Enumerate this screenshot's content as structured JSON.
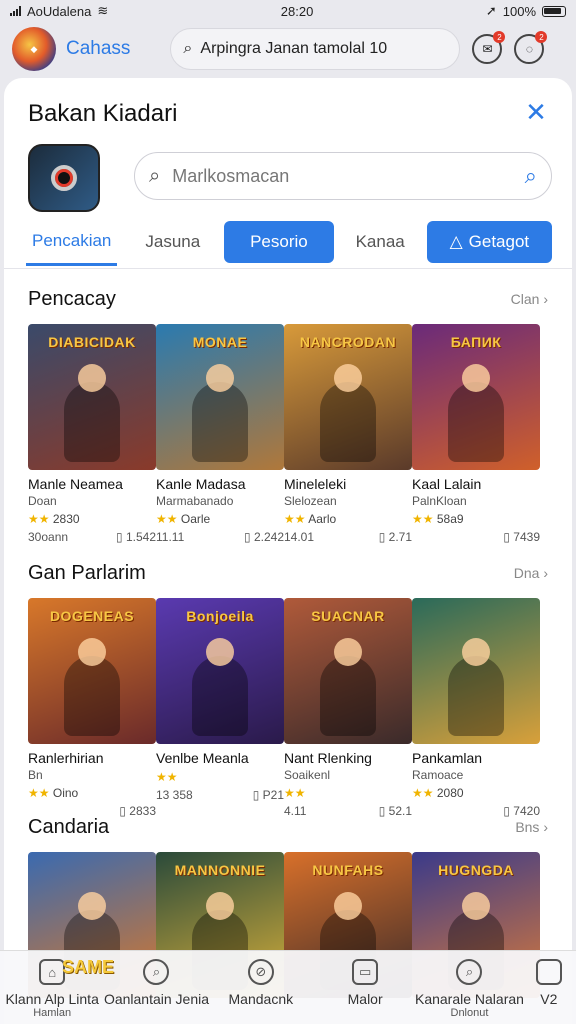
{
  "status": {
    "carrier": "AoUdalena",
    "time": "28:20",
    "battery": "100%"
  },
  "topbar": {
    "app_name": "Cahass",
    "search_text": "Arpingra Janan tamolal 10",
    "notif1": "2",
    "notif2": "2"
  },
  "card": {
    "title": "Bakan Kiadari",
    "search": {
      "placeholder": "Marlkosmacan"
    },
    "tabs": [
      "Pencakian",
      "Jasuna",
      "Pesorio",
      "Kanaa",
      "Getagot"
    ]
  },
  "sections": [
    {
      "title": "Pencacay",
      "more": "Clan",
      "games": [
        {
          "name": "Manle Neamea",
          "sub": "Doan",
          "rating": "2830",
          "s1": "30oann",
          "s2": "1.542",
          "logo": "DIABICIDAK",
          "c1": "#3a4a6a",
          "c2": "#8a3a2a"
        },
        {
          "name": "Kanle Madasa",
          "sub": "Marmabanado",
          "rating": "Oarle",
          "s1": "11.11",
          "s2": "2.242",
          "logo": "MONAE",
          "c1": "#2a7ab0",
          "c2": "#b0783a"
        },
        {
          "name": "Mineleleki",
          "sub": "Slelozean",
          "rating": "Aarlo",
          "s1": "14.01",
          "s2": "2.71",
          "logo": "NANCRODAN",
          "c1": "#d89a3a",
          "c2": "#5a3a2a"
        },
        {
          "name": "Kaal Lalain",
          "sub": "PalnKloan",
          "rating": "58a9",
          "s1": "",
          "s2": "7439",
          "logo": "БАПИК",
          "c1": "#6a2a7a",
          "c2": "#d0602a"
        }
      ]
    },
    {
      "title": "Gan Parlarim",
      "more": "Dna",
      "games": [
        {
          "name": "Ranlerhirian",
          "sub": "Bn",
          "rating": "Oino",
          "s1": "",
          "s2": "2833",
          "logo": "DOGENEAS",
          "c1": "#d8782a",
          "c2": "#6a2a2a"
        },
        {
          "name": "Venlbe Meanla",
          "sub": "",
          "rating": "",
          "s1": "13 358",
          "s2": "P21",
          "logo": "Bonjoeila",
          "c1": "#5a3ab0",
          "c2": "#2a1a4a"
        },
        {
          "name": "Nant Rlenking",
          "sub": "Soaikenl",
          "rating": "",
          "s1": "4.11",
          "s2": "52.1",
          "logo": "SUACNAR",
          "c1": "#b05a3a",
          "c2": "#3a2a2a"
        },
        {
          "name": "Pankamlan",
          "sub": "Ramoace",
          "rating": "2080",
          "s1": "",
          "s2": "7420",
          "logo": "",
          "c1": "#2a6a5a",
          "c2": "#d8a03a"
        }
      ]
    },
    {
      "title": "Candaria",
      "more": "Bns",
      "games": [
        {
          "name": "",
          "sub": "",
          "rating": "",
          "s1": "",
          "s2": "",
          "logo": "",
          "c1": "#3a6ab0",
          "c2": "#d8782a"
        },
        {
          "name": "",
          "sub": "",
          "rating": "",
          "s1": "",
          "s2": "",
          "logo": "MANNONNIE",
          "c1": "#2a4a3a",
          "c2": "#d8b03a"
        },
        {
          "name": "",
          "sub": "",
          "rating": "",
          "s1": "",
          "s2": "",
          "logo": "NUNFAHS",
          "c1": "#d8702a",
          "c2": "#3a2a2a"
        },
        {
          "name": "",
          "sub": "",
          "rating": "",
          "s1": "",
          "s2": "",
          "logo": "HUGNGDA",
          "c1": "#3a3a8a",
          "c2": "#d87a3a"
        }
      ]
    }
  ],
  "bottomnav": {
    "badge": "SAME",
    "items": [
      {
        "label": "Klann Alp Linta",
        "sub": "Hamlan"
      },
      {
        "label": "Oanlantain Jenia",
        "sub": ""
      },
      {
        "label": "Mandacnk",
        "sub": ""
      },
      {
        "label": "Malor",
        "sub": ""
      },
      {
        "label": "Kanarale Nalaran",
        "sub": "Dnlonut"
      },
      {
        "label": "V2",
        "sub": ""
      }
    ]
  }
}
